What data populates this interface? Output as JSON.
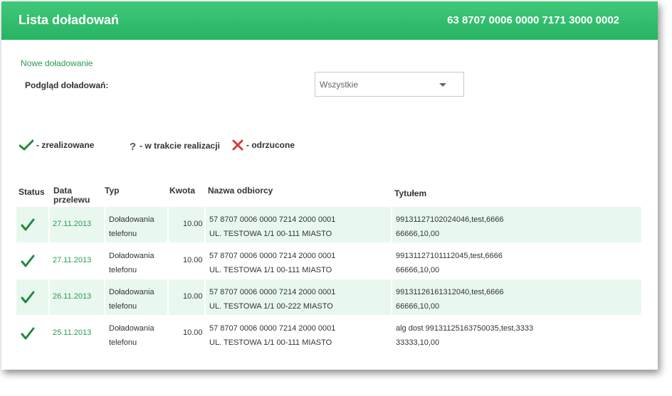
{
  "header": {
    "title": "Lista doładowań",
    "account": "63 8707 0006 0000 7171 3000 0002"
  },
  "actions": {
    "new_topup": "Nowe doładowanie"
  },
  "filter": {
    "label": "Podgląd doładowań:",
    "selected": "Wszystkie"
  },
  "legend": {
    "done": "- zrealizowane",
    "pending": "- w trakcie realizacji",
    "rejected": "- odrzucone"
  },
  "table": {
    "headers": {
      "status": "Status",
      "date_line1": "Data",
      "date_line2": "przelewu",
      "type": "Typ",
      "amount": "Kwota",
      "recipient": "Nazwa odbiorcy",
      "title": "Tytułem"
    },
    "rows": [
      {
        "status": "done",
        "date": "27.11.2013",
        "type_line1": "Doładowania",
        "type_line2": "telefonu",
        "amount": "10.00",
        "recipient_line1": "57 8707 0006 0000 7214 2000 0001",
        "recipient_line2": "UL. TESTOWA 1/1 00-111 MIASTO",
        "title_line1": "99131127102024046,test,6666",
        "title_line2": "66666,10,00"
      },
      {
        "status": "done",
        "date": "27.11.2013",
        "type_line1": "Doładowania",
        "type_line2": "telefonu",
        "amount": "10.00",
        "recipient_line1": "57 8707 0006 0000 7214 2000 0001",
        "recipient_line2": "UL. TESTOWA 1/1 00-111 MIASTO",
        "title_line1": "99131127101112045,test,6666",
        "title_line2": "66666,10,00"
      },
      {
        "status": "done",
        "date": "26.11.2013",
        "type_line1": "Doładowania",
        "type_line2": "telefonu",
        "amount": "10.00",
        "recipient_line1": "57 8707 0006 0000 7214 2000 0001",
        "recipient_line2": "UL. TESTOWA 1/1 00-222 MIASTO",
        "title_line1": "99131126161312040,test,6666",
        "title_line2": "66666,10,00"
      },
      {
        "status": "done",
        "date": "25.11.2013",
        "type_line1": "Doładowania",
        "type_line2": "telefonu",
        "amount": "10.00",
        "recipient_line1": "57 8707 0006 0000 7214 2000 0001",
        "recipient_line2": "UL. TESTOWA 1/1 00-111 MIASTO",
        "title_line1": "alg dost 99131125163750035,test,3333",
        "title_line2": "33333,10,00"
      }
    ]
  },
  "colors": {
    "header_green": "#2fbb6b",
    "link_green": "#2a9a55",
    "check_green": "#1f8a3e",
    "reject_red": "#d93a3a",
    "row_alt": "#e9f8ee"
  }
}
